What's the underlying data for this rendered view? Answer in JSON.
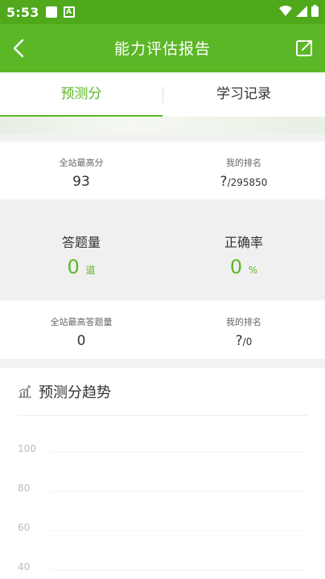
{
  "status_bar": {
    "time": "5:53"
  },
  "app_bar": {
    "title": "能力评估报告"
  },
  "tabs": [
    {
      "label": "预测分",
      "active": true
    },
    {
      "label": "学习记录",
      "active": false
    }
  ],
  "stats": {
    "site_high_score_label": "全站最高分",
    "site_high_score_value": "93",
    "my_rank_label": "我的排名",
    "my_rank_value": "?",
    "my_rank_total": "/295850",
    "answered_label": "答题量",
    "answered_value": "0",
    "answered_unit": "道",
    "accuracy_label": "正确率",
    "accuracy_value": "0",
    "accuracy_unit": "%",
    "site_high_answered_label": "全站最高答题量",
    "site_high_answered_value": "0",
    "my_rank2_label": "我的排名",
    "my_rank2_value": "?",
    "my_rank2_total": "/0"
  },
  "trend": {
    "title": "预测分趋势"
  },
  "chart_data": {
    "type": "line",
    "x": [],
    "series": [],
    "yticks": [
      100,
      80,
      60,
      40
    ],
    "ylim": [
      40,
      100
    ],
    "grid": true
  },
  "colors": {
    "primary": "#5cb727",
    "status_bar": "#4fa91b",
    "accent_text": "#5cb727"
  }
}
